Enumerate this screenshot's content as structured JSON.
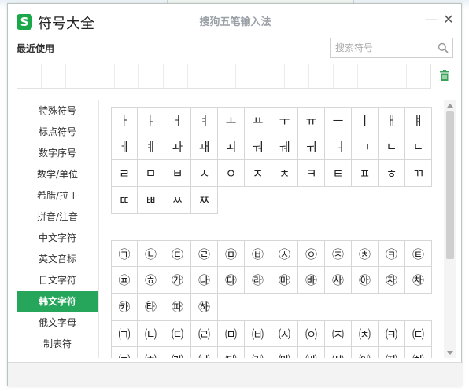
{
  "window": {
    "app_title": "符号大全",
    "caption": "搜狗五笔输入法",
    "logo_text": "S",
    "minimize_label": "—",
    "close_label": "✕"
  },
  "recent": {
    "label": "最近使用",
    "slot_count": 17
  },
  "search": {
    "placeholder": "搜索符号",
    "icon": "search-icon"
  },
  "sidebar": {
    "items": [
      {
        "label": "特殊符号",
        "active": false
      },
      {
        "label": "标点符号",
        "active": false
      },
      {
        "label": "数字序号",
        "active": false
      },
      {
        "label": "数学/单位",
        "active": false
      },
      {
        "label": "希腊/拉丁",
        "active": false
      },
      {
        "label": "拼音/注音",
        "active": false
      },
      {
        "label": "中文字符",
        "active": false
      },
      {
        "label": "英文音标",
        "active": false
      },
      {
        "label": "日文字符",
        "active": false
      },
      {
        "label": "韩文字符",
        "active": true
      },
      {
        "label": "俄文字母",
        "active": false
      },
      {
        "label": "制表符",
        "active": false
      }
    ]
  },
  "symbols": {
    "jamo": [
      "ㅏ",
      "ㅑ",
      "ㅓ",
      "ㅕ",
      "ㅗ",
      "ㅛ",
      "ㅜ",
      "ㅠ",
      "ㅡ",
      "ㅣ",
      "ㅐ",
      "ㅒ",
      "ㅔ",
      "ㅖ",
      "ㅘ",
      "ㅙ",
      "ㅚ",
      "ㅝ",
      "ㅞ",
      "ㅟ",
      "ㅢ",
      "ㄱ",
      "ㄴ",
      "ㄷ",
      "ㄹ",
      "ㅁ",
      "ㅂ",
      "ㅅ",
      "ㅇ",
      "ㅈ",
      "ㅊ",
      "ㅋ",
      "ㅌ",
      "ㅍ",
      "ㅎ",
      "ㄲ",
      "ㄸ",
      "ㅃ",
      "ㅆ",
      "ㅉ"
    ],
    "circled": [
      "㉠",
      "㉡",
      "㉢",
      "㉣",
      "㉤",
      "㉥",
      "㉦",
      "㉧",
      "㉨",
      "㉩",
      "㉪",
      "㉫",
      "㉬",
      "㉭",
      "㉮",
      "㉯",
      "㉰",
      "㉱",
      "㉲",
      "㉳",
      "㉴",
      "㉵",
      "㉶",
      "㉷",
      "㉸",
      "㉹",
      "㉺",
      "㉻"
    ],
    "parenthesized": [
      "㈀",
      "㈁",
      "㈂",
      "㈃",
      "㈄",
      "㈅",
      "㈆",
      "㈇",
      "㈈",
      "㈉",
      "㈊",
      "㈋",
      "㈌",
      "㈍",
      "㈎",
      "㈏",
      "㈐",
      "㈑",
      "㈒",
      "㈓",
      "㈔",
      "㈕",
      "㈖",
      "㈗"
    ]
  },
  "colors": {
    "accent": "#26a65b",
    "trash": "#3aa35a"
  }
}
